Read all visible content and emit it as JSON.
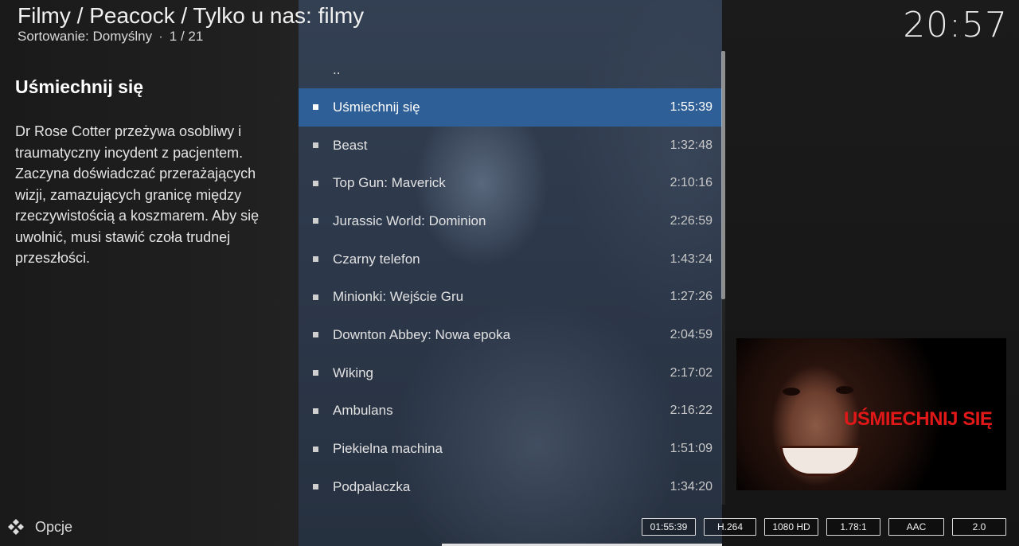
{
  "header": {
    "breadcrumb": "Filmy / Peacock / Tylko u nas: filmy",
    "sort_label": "Sortowanie: Domyślny",
    "dot": "·",
    "position": "1 / 21",
    "clock": "20:57"
  },
  "info": {
    "title": "Uśmiechnij się",
    "plot": "Dr Rose Cotter przeżywa osobliwy i traumatyczny incydent z pacjentem. Zaczyna doświadczać przerażających wizji, zamazujących granicę między rzeczywistością a koszmarem. Aby się uwolnić, musi stawić czoła trudnej przeszłości."
  },
  "list": {
    "parent_label": "..",
    "items": [
      {
        "label": "Uśmiechnij się",
        "duration": "1:55:39",
        "selected": true
      },
      {
        "label": "Beast",
        "duration": "1:32:48"
      },
      {
        "label": "Top Gun: Maverick",
        "duration": "2:10:16"
      },
      {
        "label": "Jurassic World: Dominion",
        "duration": "2:26:59"
      },
      {
        "label": "Czarny telefon",
        "duration": "1:43:24"
      },
      {
        "label": "Minionki: Wejście Gru",
        "duration": "1:27:26"
      },
      {
        "label": "Downton Abbey: Nowa epoka",
        "duration": "2:04:59"
      },
      {
        "label": "Wiking",
        "duration": "2:17:02"
      },
      {
        "label": "Ambulans",
        "duration": "2:16:22"
      },
      {
        "label": "Piekielna machina",
        "duration": "1:51:09"
      },
      {
        "label": "Podpalaczka",
        "duration": "1:34:20"
      }
    ]
  },
  "poster": {
    "title_text": "UŚMIECHNIJ SIĘ"
  },
  "footer": {
    "options_label": "Opcje",
    "options_icon": "kodi-logo-icon",
    "flags": [
      {
        "name": "duration-flag",
        "text": "01:55:39"
      },
      {
        "name": "video-codec-flag",
        "text": "H.264"
      },
      {
        "name": "resolution-flag",
        "text": "1080 HD"
      },
      {
        "name": "aspect-ratio-flag",
        "text": "1.78:1"
      },
      {
        "name": "audio-codec-flag",
        "text": "AAC"
      },
      {
        "name": "audio-channels-flag",
        "text": "2.0"
      }
    ]
  },
  "colors": {
    "selection": "#2e5f96",
    "poster_title": "#e01818"
  }
}
